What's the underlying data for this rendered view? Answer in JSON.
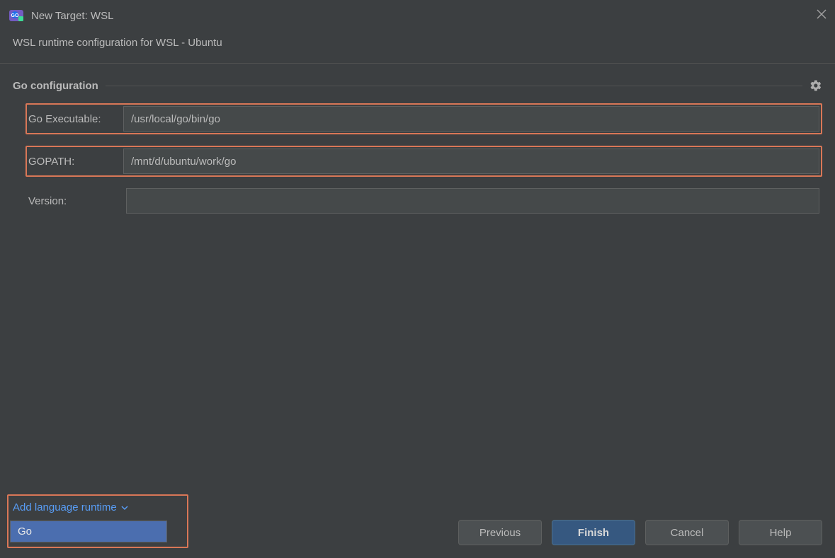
{
  "window": {
    "title": "New Target: WSL",
    "subtitle": "WSL runtime configuration for WSL - Ubuntu"
  },
  "section": {
    "title": "Go configuration",
    "fields": {
      "executable": {
        "label": "Go Executable:",
        "value": "/usr/local/go/bin/go"
      },
      "gopath": {
        "label": "GOPATH:",
        "value": "/mnt/d/ubuntu/work/go"
      },
      "version": {
        "label": "Version:",
        "value": ""
      }
    }
  },
  "addRuntime": {
    "link": "Add language runtime",
    "options": [
      "Go"
    ]
  },
  "buttons": {
    "previous": "Previous",
    "finish": "Finish",
    "cancel": "Cancel",
    "help": "Help"
  }
}
